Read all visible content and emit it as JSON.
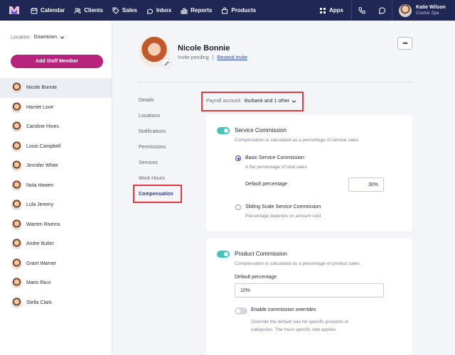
{
  "nav": {
    "items": [
      {
        "label": "Calendar",
        "icon": "calendar-icon"
      },
      {
        "label": "Clients",
        "icon": "users-icon"
      },
      {
        "label": "Sales",
        "icon": "tag-icon"
      },
      {
        "label": "Inbox",
        "icon": "inbox-icon"
      },
      {
        "label": "Reports",
        "icon": "bar-chart-icon"
      },
      {
        "label": "Products",
        "icon": "bag-icon"
      }
    ],
    "apps_label": "Apps",
    "user": {
      "name": "Katie Wilson",
      "business": "Cosmic Spa"
    }
  },
  "sidebar": {
    "location_label": "Location:",
    "location_value": "Downtown",
    "add_button": "Add Staff Member",
    "staff": [
      "Nicole Bonnie",
      "Harriet Love",
      "Caroline Hines",
      "Louis Campbell",
      "Jennifer White",
      "Nola Howen",
      "Lula Jeremy",
      "Warren Riverra",
      "Andre Butler",
      "Grant Warner",
      "Mario Ricci",
      "Stella Clark"
    ],
    "active_index": 0
  },
  "profile": {
    "name": "Nicole Bonnie",
    "status": "Invite pending",
    "separator": "|",
    "resend": "Resend invite",
    "more": "•••"
  },
  "tabs": [
    "Details",
    "Locations",
    "Notifications",
    "Permissions",
    "Services",
    "Work Hours",
    "Compensation"
  ],
  "active_tab": "Compensation",
  "payroll": {
    "label": "Payroll account:",
    "value": "Burbank and 1 other"
  },
  "service_commission": {
    "enabled": true,
    "title": "Service Commission",
    "subtitle": "Compensation is calculated as a percentage of service sales",
    "basic_title": "Basic Service Commission",
    "basic_sub": "A flat percentage of total sales",
    "default_label": "Default percentage",
    "default_value": "30%",
    "sliding_title": "Sliding Scale Service Commission",
    "sliding_sub": "Percentage depends on amount sold",
    "selected": "basic"
  },
  "product_commission": {
    "enabled": true,
    "title": "Product Commission",
    "subtitle": "Compensation is calculated as a percentage of product sales",
    "default_label": "Default percentage",
    "default_value": "10%",
    "overrides_enabled": false,
    "overrides_label": "Enable commission overrides",
    "overrides_sub_1": "Override the default rate for specific products or",
    "overrides_sub_2": "categories. The most specific rate applies."
  },
  "colors": {
    "nav_bg": "#1f2754",
    "primary_button": "#b5247a",
    "toggle_on": "#45c3b7",
    "active_tab": "#2b3f9a",
    "highlight": "#e03a3a"
  }
}
